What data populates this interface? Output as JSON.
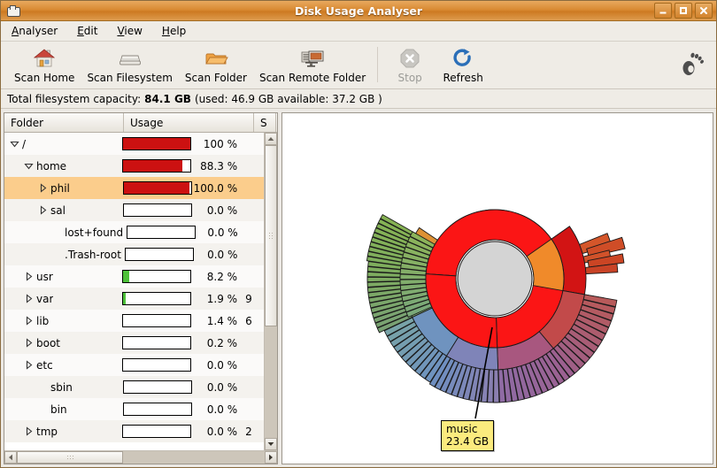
{
  "window": {
    "title": "Disk Usage Analyser",
    "icon": "disk-icon",
    "buttons": {
      "minimize": "_",
      "maximize": "□",
      "close": "✕"
    }
  },
  "menubar": {
    "items": [
      {
        "mnemonic": "A",
        "rest": "nalyser"
      },
      {
        "mnemonic": "E",
        "rest": "dit"
      },
      {
        "mnemonic": "V",
        "rest": "iew"
      },
      {
        "mnemonic": "H",
        "rest": "elp"
      }
    ]
  },
  "toolbar": {
    "items": [
      {
        "label": "Scan Home",
        "icon": "home-icon",
        "enabled": true
      },
      {
        "label": "Scan Filesystem",
        "icon": "harddisk-icon",
        "enabled": true
      },
      {
        "label": "Scan Folder",
        "icon": "folder-icon",
        "enabled": true
      },
      {
        "label": "Scan Remote Folder",
        "icon": "remote-folder-icon",
        "enabled": true
      },
      {
        "label": "Stop",
        "icon": "stop-icon",
        "enabled": false
      },
      {
        "label": "Refresh",
        "icon": "refresh-icon",
        "enabled": true
      }
    ],
    "branding_icon": "gnome-foot-icon"
  },
  "capacity": {
    "prefix": "Total filesystem capacity:",
    "total": "84.1 GB",
    "suffix": "(used: 46.9 GB available: 37.2 GB )"
  },
  "tree": {
    "columns": [
      "Folder",
      "Usage",
      "S"
    ],
    "rows": [
      {
        "name": "/",
        "indent": 0,
        "expander": "down",
        "percent": "100 %",
        "fill": 100,
        "color": "#cc1111",
        "size": ""
      },
      {
        "name": "home",
        "indent": 1,
        "expander": "down",
        "percent": "88.3 %",
        "fill": 88.3,
        "color": "#cc1111",
        "size": ""
      },
      {
        "name": "phil",
        "indent": 2,
        "expander": "right",
        "percent": "100.0 %",
        "fill": 97,
        "color": "#cc1111",
        "size": "",
        "selected": true
      },
      {
        "name": "sal",
        "indent": 2,
        "expander": "right",
        "percent": "0.0 %",
        "fill": 0,
        "color": "#cc1111",
        "size": ""
      },
      {
        "name": "lost+found",
        "indent": 3,
        "expander": "none",
        "percent": "0.0 %",
        "fill": 0,
        "color": "#cc1111",
        "size": ""
      },
      {
        "name": ".Trash-root",
        "indent": 3,
        "expander": "none",
        "percent": "0.0 %",
        "fill": 0,
        "color": "#cc1111",
        "size": ""
      },
      {
        "name": "usr",
        "indent": 1,
        "expander": "right",
        "percent": "8.2 %",
        "fill": 9,
        "color": "#4ec13a",
        "size": ""
      },
      {
        "name": "var",
        "indent": 1,
        "expander": "right",
        "percent": "1.9 %",
        "fill": 3,
        "color": "#4ec13a",
        "size": "9"
      },
      {
        "name": "lib",
        "indent": 1,
        "expander": "right",
        "percent": "1.4 %",
        "fill": 0,
        "color": "#4ec13a",
        "size": "6"
      },
      {
        "name": "boot",
        "indent": 1,
        "expander": "right",
        "percent": "0.2 %",
        "fill": 0,
        "color": "#4ec13a",
        "size": ""
      },
      {
        "name": "etc",
        "indent": 1,
        "expander": "right",
        "percent": "0.0 %",
        "fill": 0,
        "color": "#4ec13a",
        "size": ""
      },
      {
        "name": "sbin",
        "indent": 2,
        "expander": "none",
        "percent": "0.0 %",
        "fill": 0,
        "color": "#4ec13a",
        "size": ""
      },
      {
        "name": "bin",
        "indent": 2,
        "expander": "none",
        "percent": "0.0 %",
        "fill": 0,
        "color": "#4ec13a",
        "size": ""
      },
      {
        "name": "tmp",
        "indent": 1,
        "expander": "right",
        "percent": "0.0 %",
        "fill": 0,
        "color": "#4ec13a",
        "size": "2"
      }
    ]
  },
  "chart": {
    "type": "sunburst",
    "tooltip": {
      "name": "music",
      "size": "23.4 GB"
    },
    "center_color": "#d4d4d4"
  },
  "colors": {
    "titlebar_accent": "#d98a33",
    "selection": "#fbcd8c",
    "bar_red": "#cc1111",
    "bar_green": "#4ec13a",
    "tooltip_bg": "#fbeb7e"
  }
}
